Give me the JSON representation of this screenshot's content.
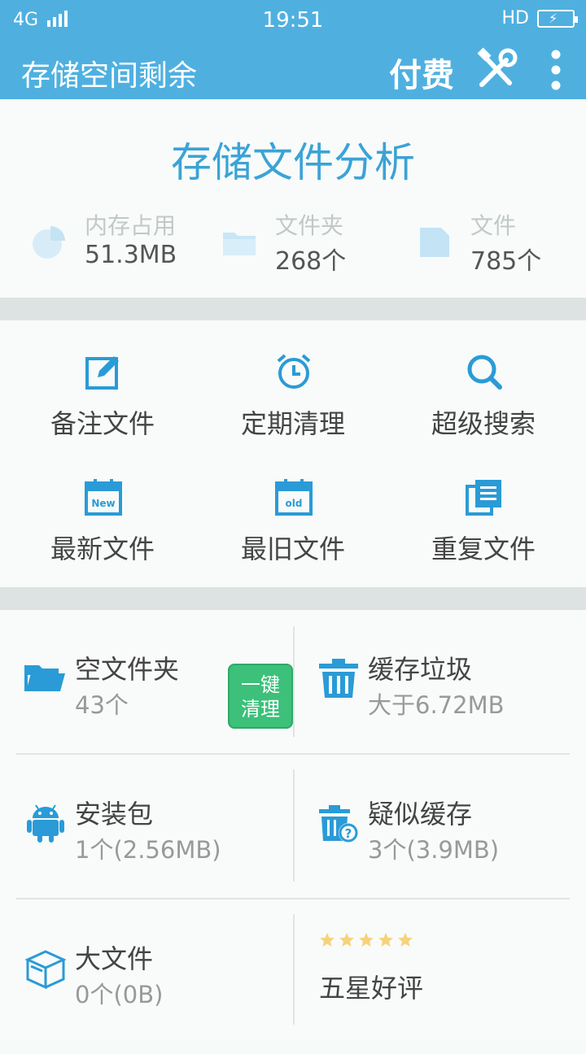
{
  "status_bar": {
    "network": "4G",
    "time": "19:51",
    "hd": "HD"
  },
  "toolbar": {
    "title": "存储空间剩余",
    "pay": "付费"
  },
  "analysis": {
    "title": "存储文件分析",
    "stats": [
      {
        "label": "内存占用",
        "value": "51.3MB",
        "icon": "pie-chart-icon"
      },
      {
        "label": "文件夹",
        "value": "268个",
        "icon": "folder-icon"
      },
      {
        "label": "文件",
        "value": "785个",
        "icon": "file-icon"
      }
    ]
  },
  "features": [
    {
      "label": "备注文件",
      "icon": "edit-icon"
    },
    {
      "label": "定期清理",
      "icon": "alarm-icon"
    },
    {
      "label": "超级搜索",
      "icon": "search-icon"
    },
    {
      "label": "最新文件",
      "icon": "calendar-new-icon",
      "badge": "New"
    },
    {
      "label": "最旧文件",
      "icon": "calendar-old-icon",
      "badge": "old"
    },
    {
      "label": "重复文件",
      "icon": "duplicate-files-icon"
    }
  ],
  "categories": [
    {
      "title": "空文件夹",
      "subtitle": "43个",
      "icon": "open-folder-icon",
      "action": "一键 清理",
      "action_line1": "一键",
      "action_line2": "清理"
    },
    {
      "title": "缓存垃圾",
      "subtitle": "大于6.72MB",
      "icon": "trash-icon"
    },
    {
      "title": "安装包",
      "subtitle": "1个(2.56MB)",
      "icon": "android-icon"
    },
    {
      "title": "疑似缓存",
      "subtitle": "3个(3.9MB)",
      "icon": "trash-question-icon"
    },
    {
      "title": "大文件",
      "subtitle": "0个(0B)",
      "icon": "box-icon"
    }
  ],
  "rating": {
    "label": "五星好评",
    "stars": 5
  },
  "colors": {
    "primary": "#4fb0e0",
    "accent": "#3ba3d6",
    "green": "#3cc07a",
    "star": "#f6d37a"
  }
}
